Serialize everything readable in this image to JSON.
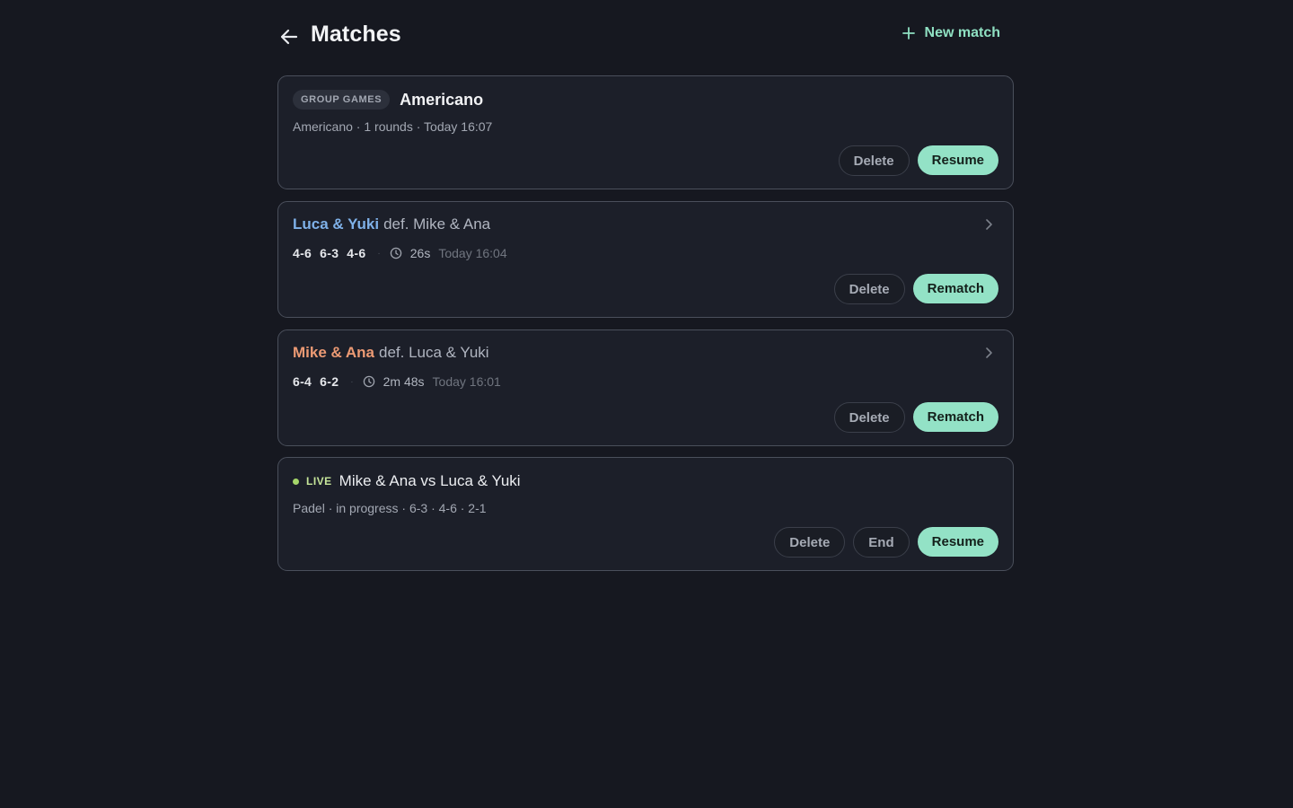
{
  "header": {
    "title": "Matches",
    "new_match_label": "New match"
  },
  "colors": {
    "accent": "#93e2c6",
    "winner_blue": "#7fb1e8",
    "winner_orange": "#ec9a74",
    "live": "#a5d66a",
    "background": "#161820",
    "card": "#1c1f29"
  },
  "cards": [
    {
      "badge": "GROUP GAMES",
      "title": "Americano",
      "meta": "Americano · 1 rounds · Today 16:07",
      "actions": {
        "delete": "Delete",
        "primary": "Resume"
      }
    },
    {
      "winner": "Luca & Yuki",
      "result": "def. Mike & Ana",
      "sets": [
        "4-6",
        "6-3",
        "4-6"
      ],
      "separator": "·",
      "duration": "26s",
      "when": "Today 16:04",
      "actions": {
        "delete": "Delete",
        "primary": "Rematch"
      }
    },
    {
      "winner": "Mike & Ana",
      "result": "def. Luca & Yuki",
      "sets": [
        "6-4",
        "6-2"
      ],
      "separator": "·",
      "duration": "2m 48s",
      "when": "Today 16:01",
      "actions": {
        "delete": "Delete",
        "primary": "Rematch"
      }
    },
    {
      "live_label": "LIVE",
      "title": "Mike & Ana vs Luca & Yuki",
      "meta": "Padel · in progress · 6-3 · 4-6 · 2-1",
      "actions": {
        "delete": "Delete",
        "end": "End",
        "primary": "Resume"
      }
    }
  ],
  "icons": {
    "back": "arrow-left-icon",
    "new": "plus-icon",
    "clock": "clock-icon",
    "chevron": "chevron-right-icon"
  }
}
